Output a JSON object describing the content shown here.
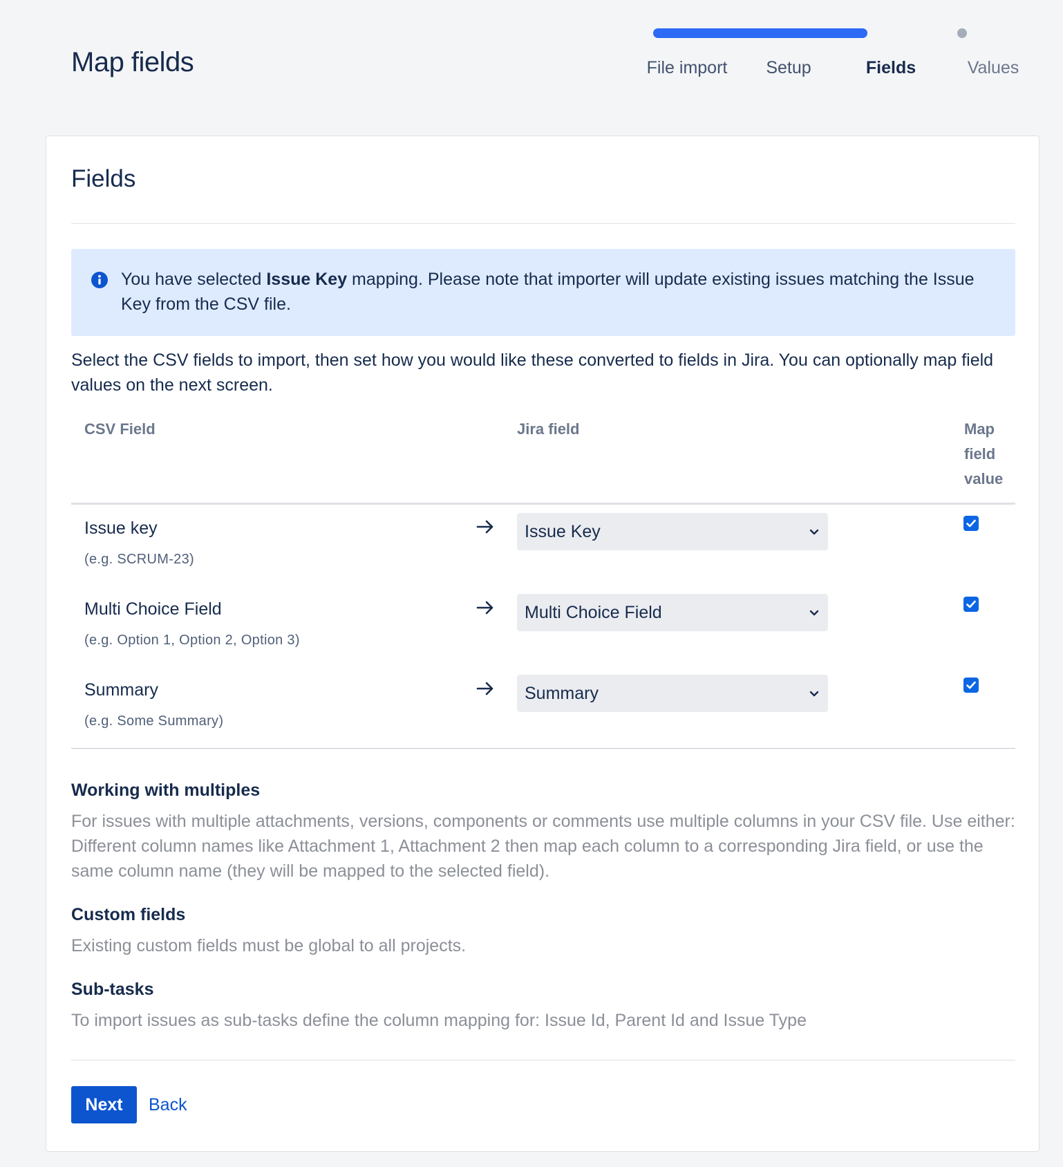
{
  "page": {
    "title": "Map fields"
  },
  "progress": {
    "steps": [
      {
        "label": "File import",
        "state": "complete"
      },
      {
        "label": "Setup",
        "state": "complete"
      },
      {
        "label": "Fields",
        "state": "current"
      },
      {
        "label": "Values",
        "state": "upcoming"
      }
    ]
  },
  "card": {
    "title": "Fields",
    "info": {
      "prefix": "You have selected ",
      "bold": "Issue Key",
      "suffix": " mapping. Please note that importer will update existing issues matching the Issue Key from the CSV file."
    },
    "intro": "Select the CSV fields to import, then set how you would like these converted to fields in Jira. You can optionally map field values on the next screen.",
    "table": {
      "headers": {
        "csv": "CSV Field",
        "jira": "Jira field",
        "map": "Map field value"
      },
      "rows": [
        {
          "name": "Issue key",
          "example": "(e.g. SCRUM-23)",
          "jira_field": "Issue Key",
          "map_value": true
        },
        {
          "name": "Multi Choice Field",
          "example": "(e.g. Option 1, Option 2, Option 3)",
          "jira_field": "Multi Choice Field",
          "map_value": true
        },
        {
          "name": "Summary",
          "example": "(e.g. Some Summary)",
          "jira_field": "Summary",
          "map_value": true
        }
      ]
    },
    "help": [
      {
        "heading": "Working with multiples",
        "text": "For issues with multiple attachments, versions, components or comments use multiple columns in your CSV file. Use either: Different column names like Attachment 1, Attachment 2 then map each column to a corresponding Jira field, or use the same column name (they will be mapped to the selected field)."
      },
      {
        "heading": "Custom fields",
        "text": "Existing custom fields must be global to all projects."
      },
      {
        "heading": "Sub-tasks",
        "text": "To import issues as sub-tasks define the column mapping for: Issue Id, Parent Id and Issue Type"
      }
    ],
    "actions": {
      "next": "Next",
      "back": "Back"
    }
  },
  "colors": {
    "accent": "#0c55cf",
    "progress": "#2d6bf5",
    "info_bg": "#deebff",
    "checkbox": "#0c66e4"
  },
  "icons": {
    "info": "info-circle-icon",
    "arrow": "arrow-right-icon",
    "chevron": "chevron-down-icon",
    "check": "checkmark-icon"
  }
}
